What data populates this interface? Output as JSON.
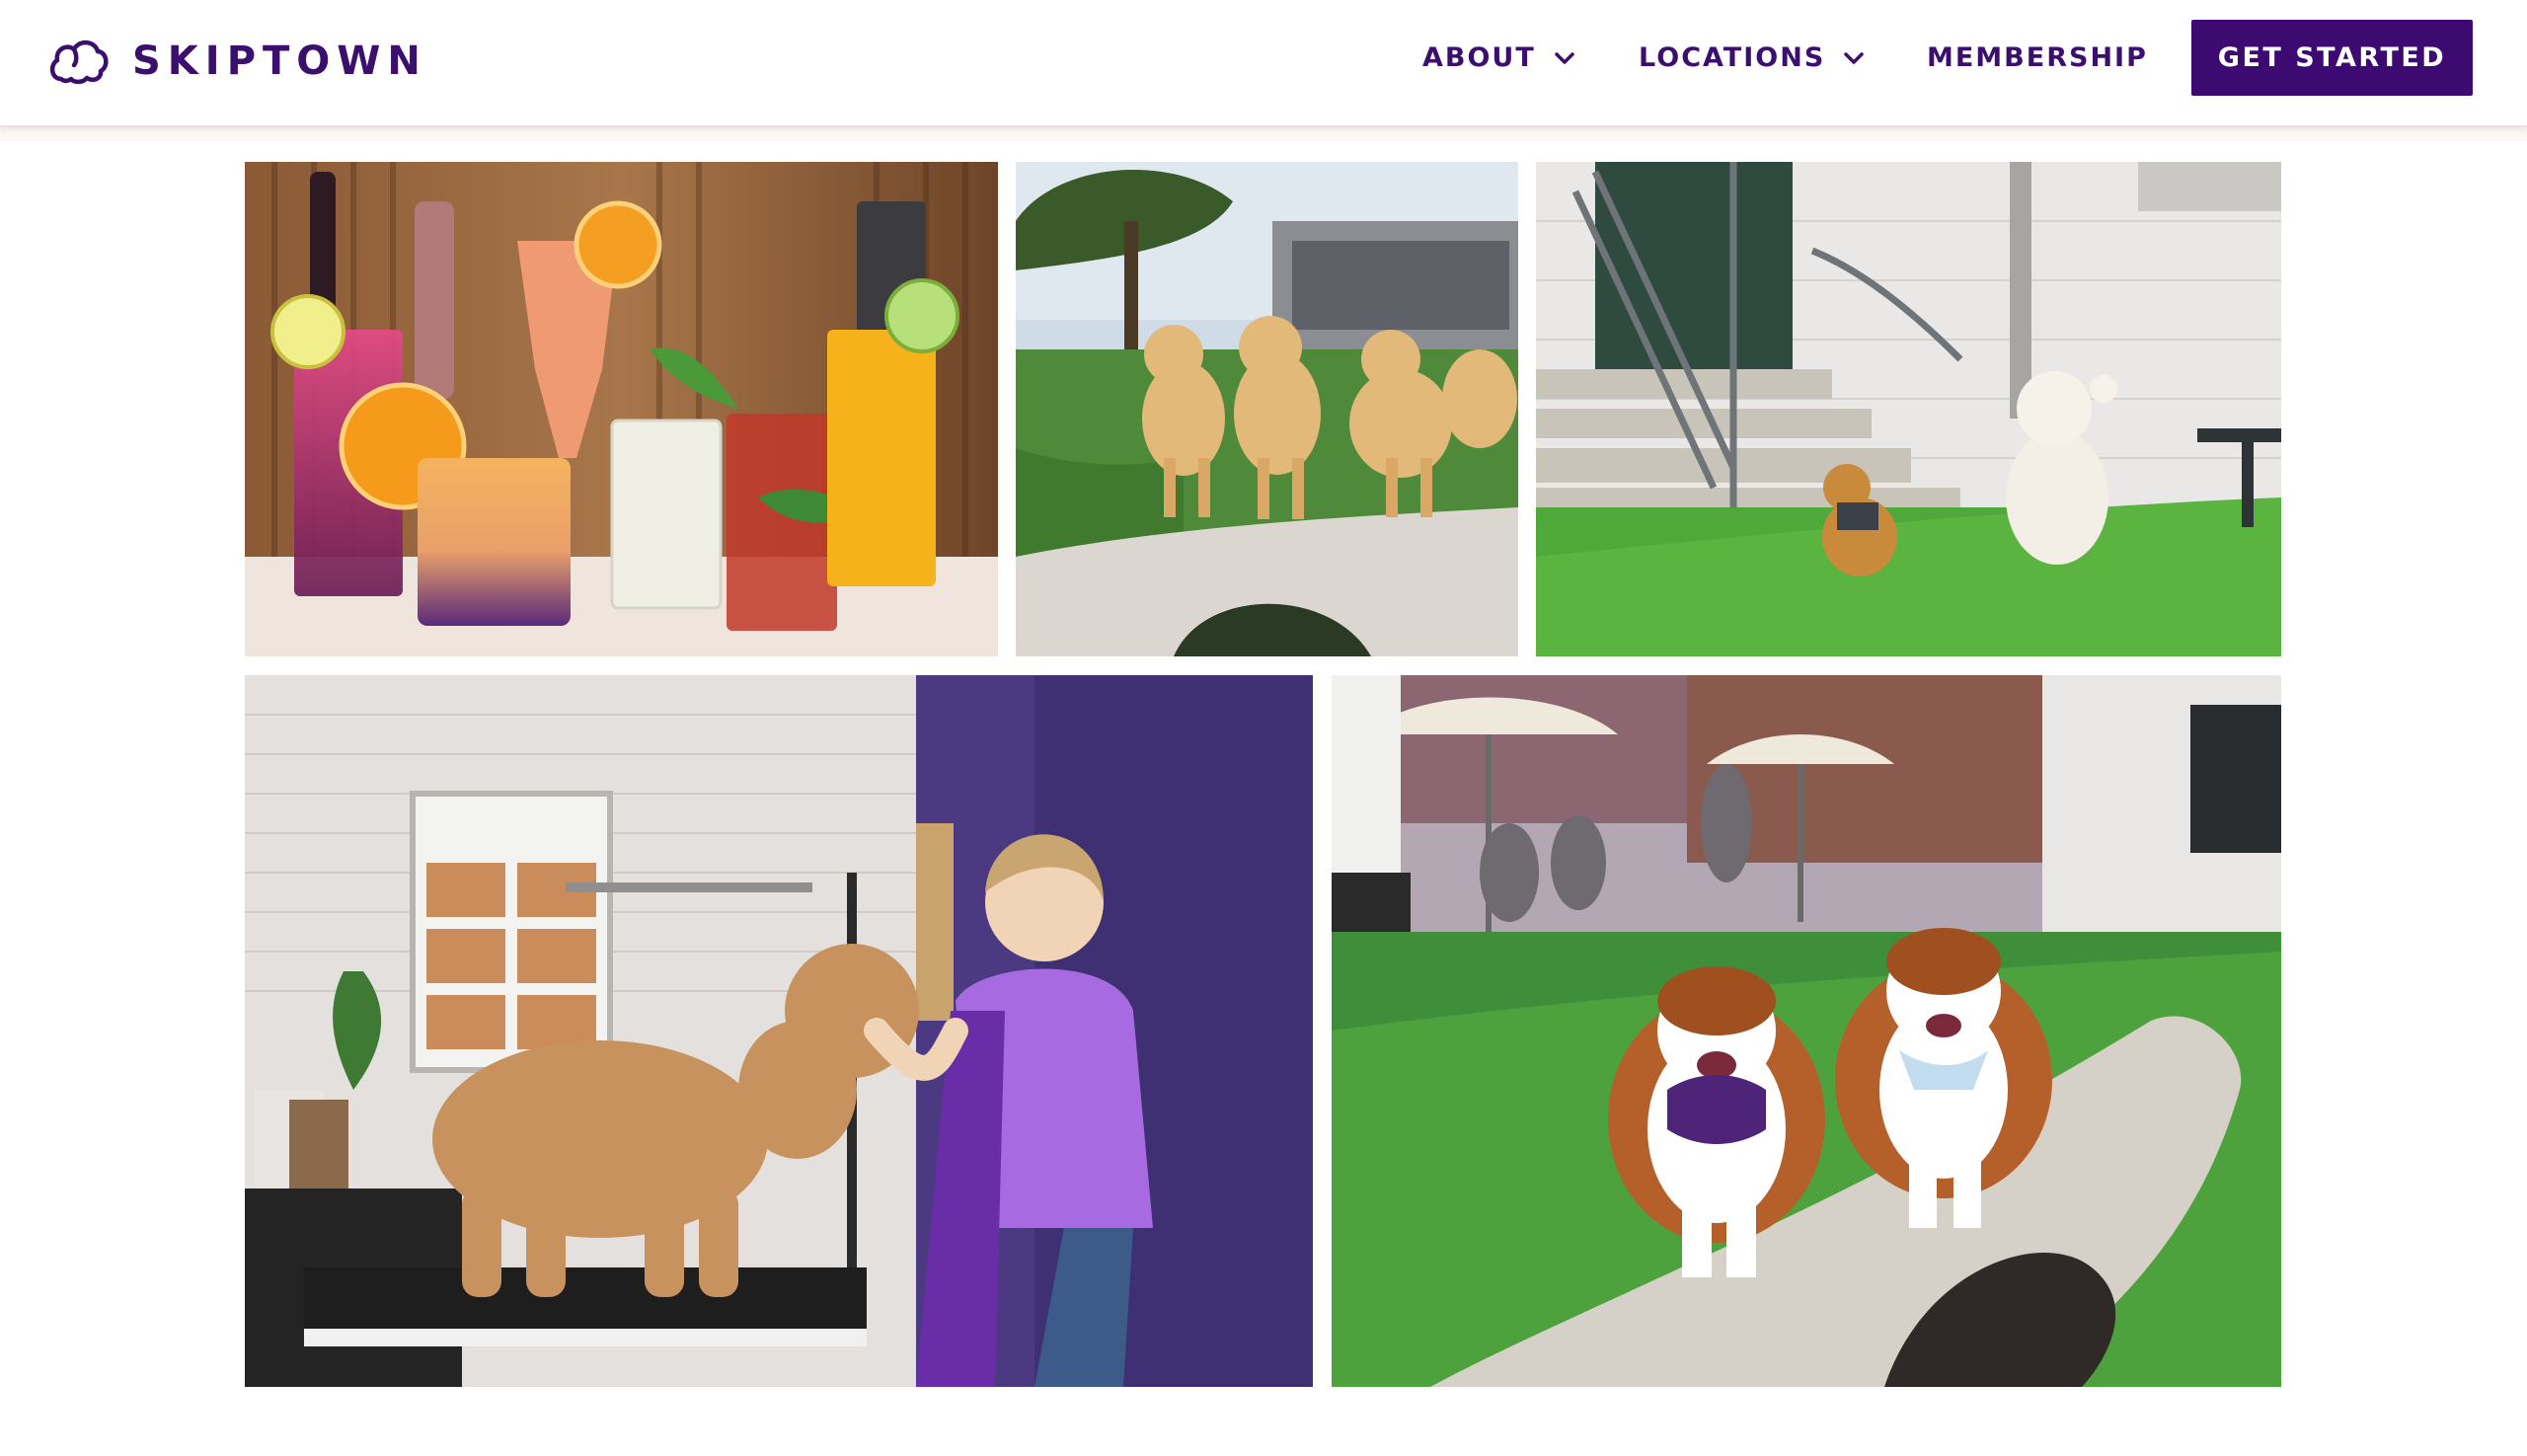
{
  "brand": {
    "name": "SKIPTOWN",
    "color": "#3a0f6e"
  },
  "nav": {
    "items": [
      {
        "label": "ABOUT",
        "has_dropdown": true
      },
      {
        "label": "LOCATIONS",
        "has_dropdown": true
      },
      {
        "label": "MEMBERSHIP",
        "has_dropdown": false
      }
    ],
    "cta_label": "GET STARTED",
    "cta_color": "#3d0a72"
  },
  "gallery": {
    "photos": [
      {
        "subject": "cocktails-on-bar"
      },
      {
        "subject": "golden-retrievers-on-bridge"
      },
      {
        "subject": "dogs-running-on-turf"
      },
      {
        "subject": "groomer-with-doodle"
      },
      {
        "subject": "cavaliers-on-bridge-patio"
      }
    ]
  },
  "icons": {
    "logo": "cloud-logo-icon",
    "dropdown": "chevron-down-icon"
  }
}
